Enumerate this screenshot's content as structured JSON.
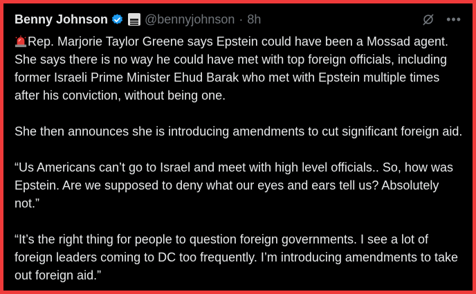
{
  "tweet": {
    "author_name": "Benny Johnson",
    "handle": "@bennyjohnson",
    "separator": "·",
    "time": "8h",
    "paragraph_1": "Rep. Marjorie Taylor Greene says Epstein could have been a Mossad agent. She says there is no way he could have met with top foreign officials, including former Israeli Prime Minister Ehud Barak who met with Epstein multiple times after his conviction, without being one.",
    "paragraph_2": "She then announces she is introducing amendments to cut significant foreign aid.",
    "paragraph_3": "“Us Americans can’t go to Israel and meet with high level officials.. So, how was Epstein. Are we supposed to deny what our eyes and ears tell us? Absolutely not.”",
    "paragraph_4": "“It’s the right thing for people to question foreign governments. I see a lot of foreign leaders coming to DC too frequently. I’m introducing amendments to take out foreign aid.”"
  },
  "icons": {
    "verified": "verified-badge-icon",
    "affiliation": "affiliation-badge-icon",
    "grok": "grok-icon",
    "more": "more-options-icon",
    "siren": "police-siren-emoji"
  },
  "colors": {
    "frame_border": "#ef3b3b",
    "background": "#000000",
    "text": "#e7e9ea",
    "muted": "#71767b",
    "verified": "#1d9bf0"
  }
}
